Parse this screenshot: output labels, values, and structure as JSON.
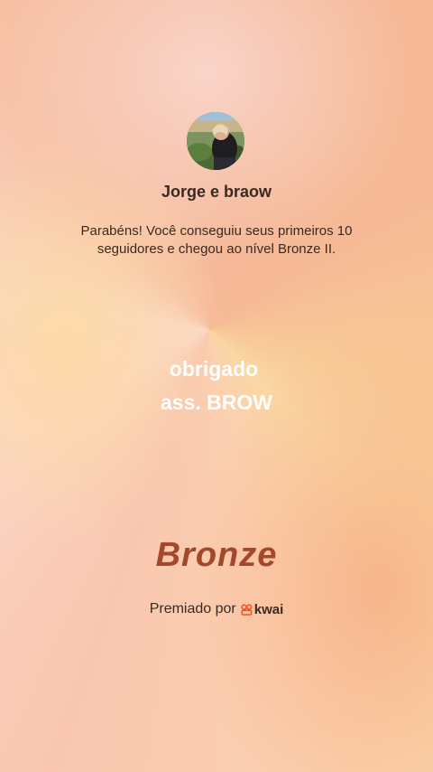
{
  "profile": {
    "username": "Jorge e braow"
  },
  "message": "Parabéns! Você conseguiu seus primeiros 10 seguidores e chegou ao nível Bronze II.",
  "caption": {
    "line1": "obrigado",
    "line2": "ass. BROW"
  },
  "level": {
    "name": "Bronze",
    "color": "#a4472c"
  },
  "awarded": {
    "label": "Premiado por",
    "brand": "kwai",
    "brand_color": "#ff4f1f",
    "icon": "kwai-logo-icon"
  }
}
